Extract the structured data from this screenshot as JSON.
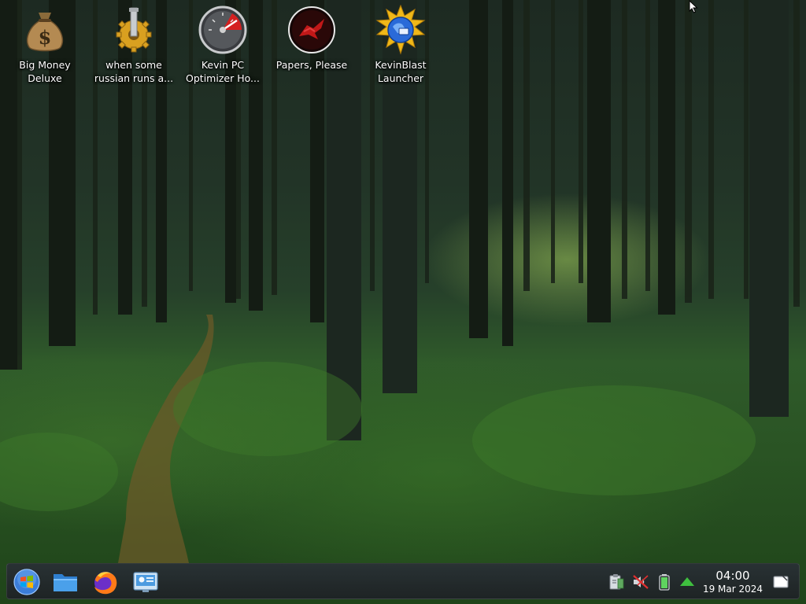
{
  "desktop": {
    "icons": [
      {
        "id": "big-money",
        "label_line1": "Big Money",
        "label_line2": "Deluxe",
        "icon": "money-bag-icon"
      },
      {
        "id": "russian",
        "label_line1": "when some",
        "label_line2": "russian runs a...",
        "icon": "gear-bolt-icon"
      },
      {
        "id": "optimizer",
        "label_line1": "Kevin PC",
        "label_line2": "Optimizer Ho...",
        "icon": "speedometer-icon"
      },
      {
        "id": "papers",
        "label_line1": "Papers, Please",
        "label_line2": "",
        "icon": "papers-please-icon"
      },
      {
        "id": "kevinblast",
        "label_line1": "KevinBlast",
        "label_line2": "Launcher",
        "icon": "kevinblast-globe-icon"
      }
    ]
  },
  "taskbar": {
    "launchers": [
      {
        "name": "start-menu-button",
        "icon": "windows-orb-icon"
      },
      {
        "name": "file-manager-button",
        "icon": "folder-icon"
      },
      {
        "name": "firefox-button",
        "icon": "firefox-icon"
      },
      {
        "name": "control-panel-button",
        "icon": "control-panel-icon"
      }
    ],
    "tray": [
      {
        "name": "clipboard-tray",
        "icon": "clipboard-icon"
      },
      {
        "name": "volume-muted-tray",
        "icon": "speaker-muted-icon"
      },
      {
        "name": "battery-tray",
        "icon": "battery-icon"
      },
      {
        "name": "updates-tray",
        "icon": "arrow-up-icon"
      }
    ],
    "clock": {
      "time": "04:00",
      "date": "19 Mar 2024"
    },
    "show_desktop_icon": "show-desktop-icon"
  },
  "colors": {
    "taskbar_bg": "#2a3036",
    "label_text": "#ffffff",
    "updates_green": "#3fbf3f",
    "battery_green": "#5fd35f"
  }
}
